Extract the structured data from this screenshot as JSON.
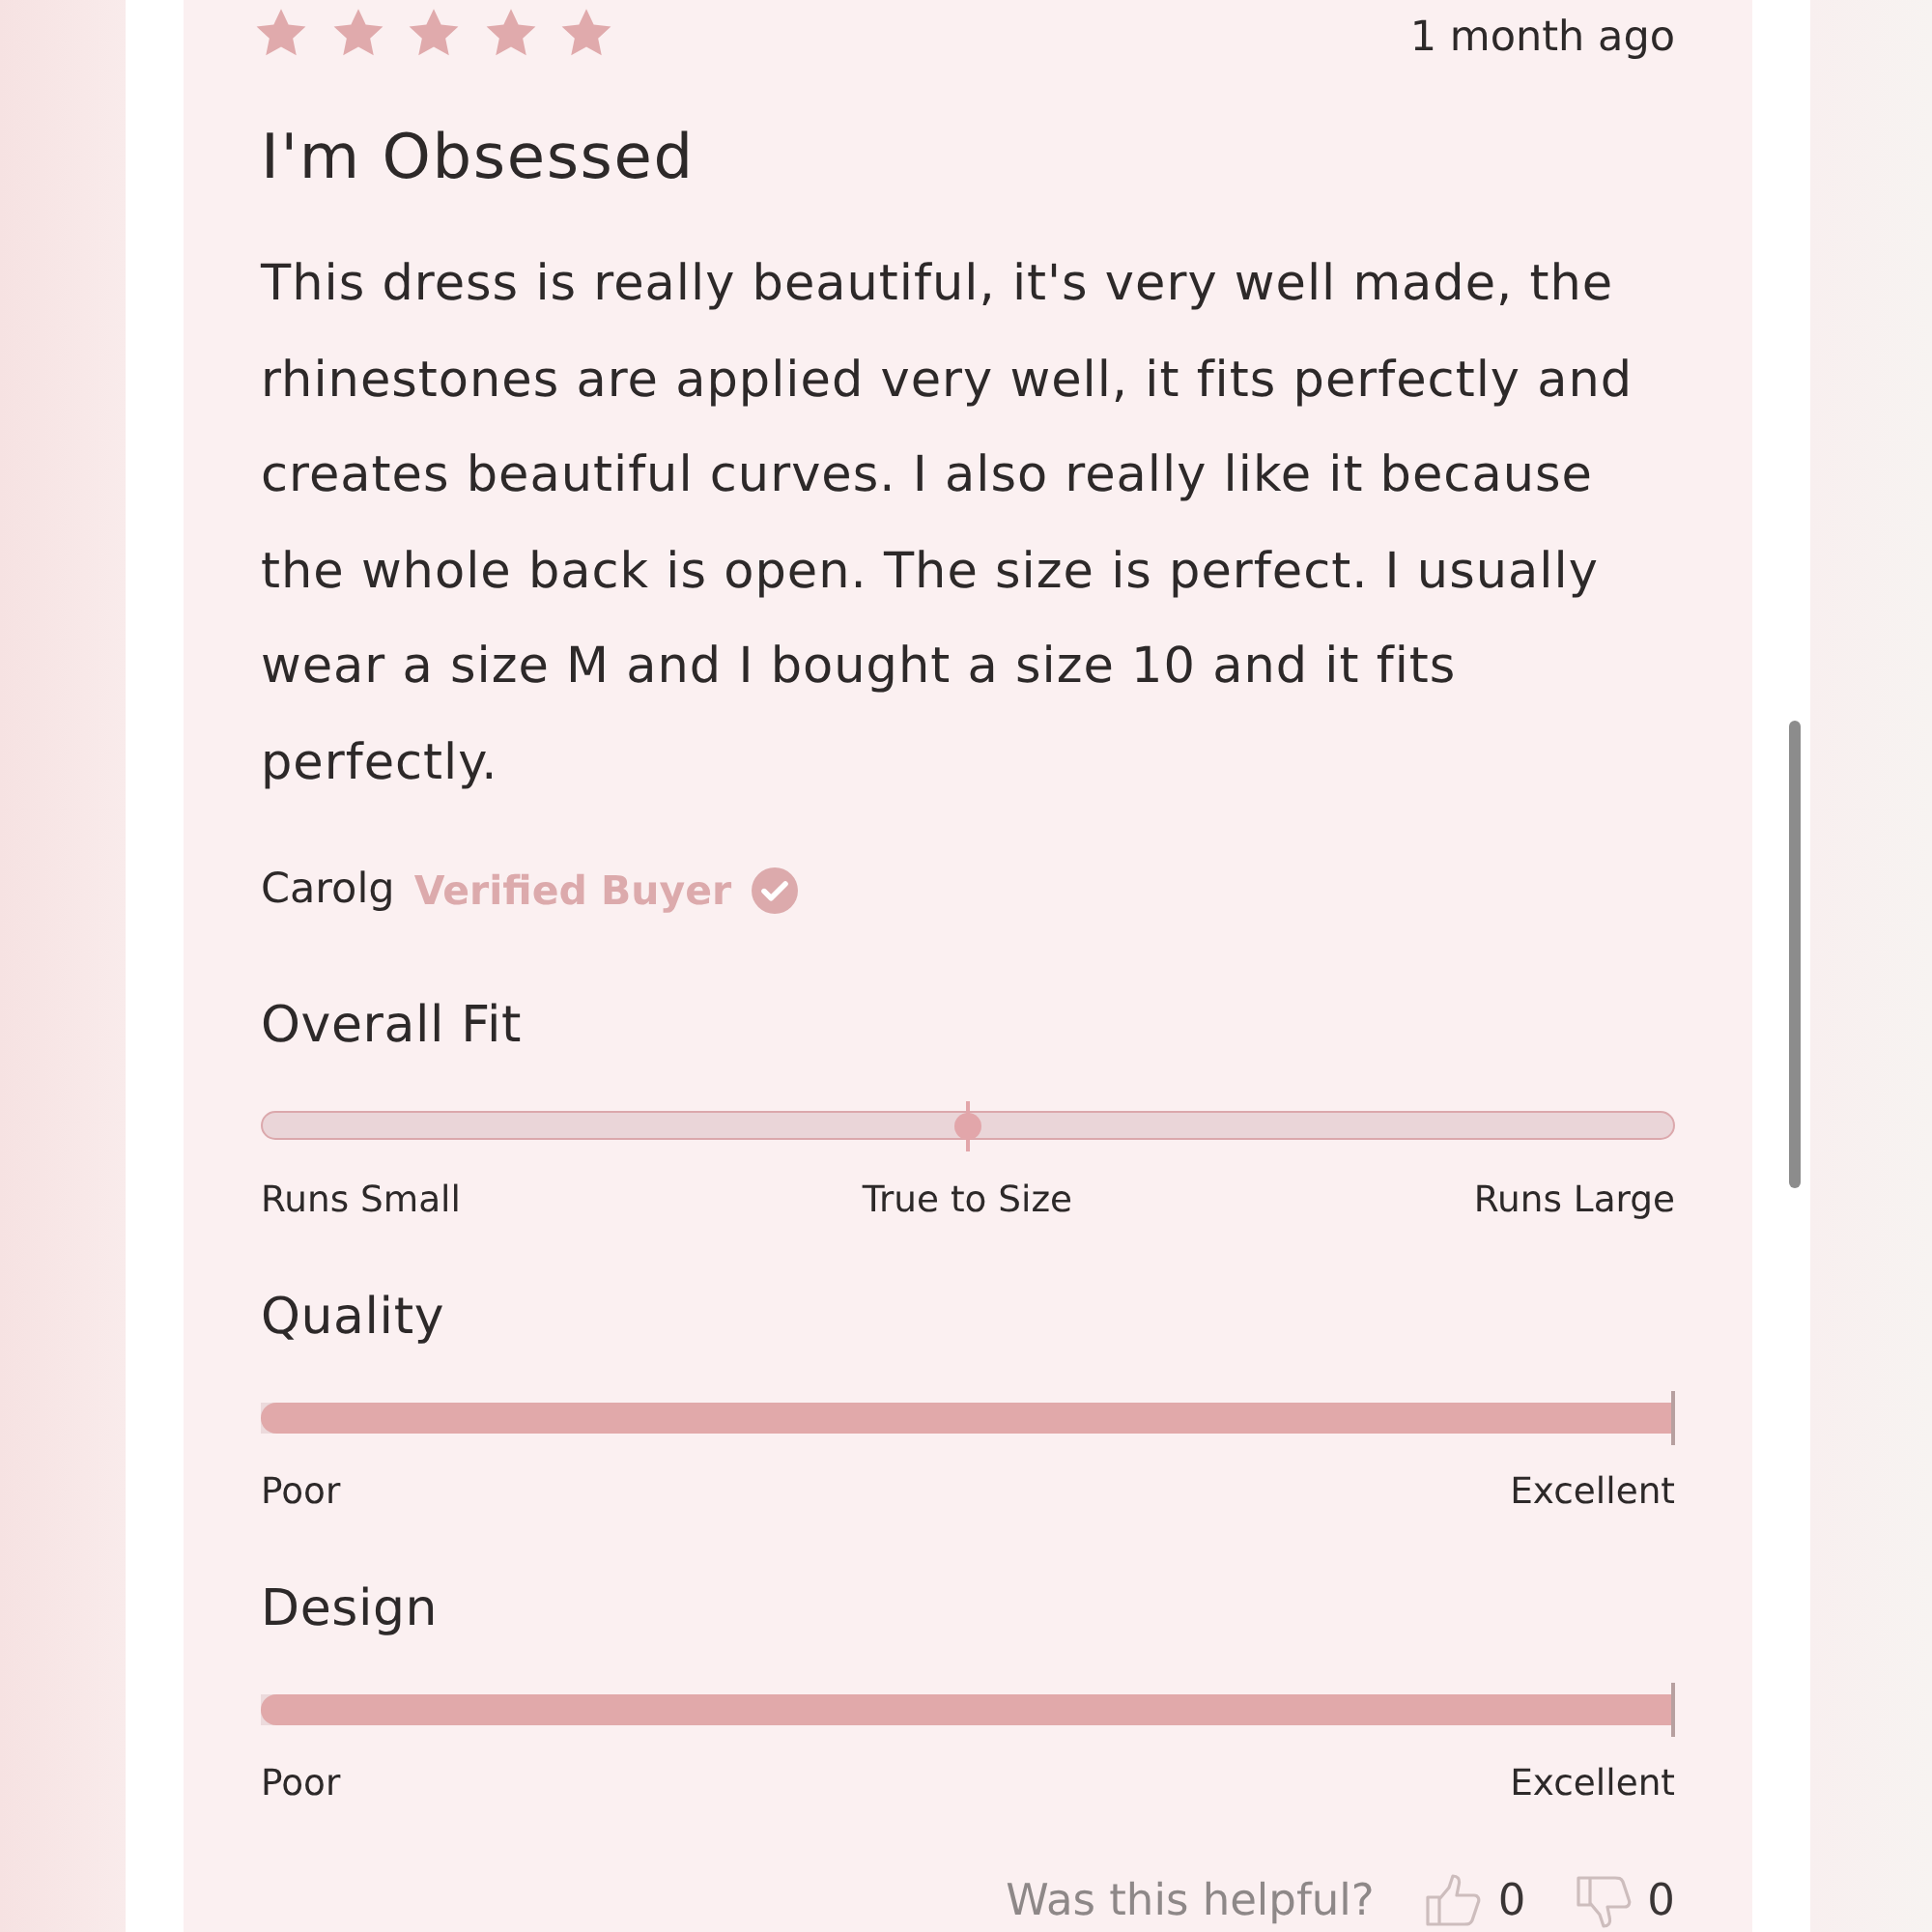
{
  "review": {
    "stars": 5,
    "time": "1 month ago",
    "title": "I'm Obsessed",
    "body": "This dress is really beautiful, it's very well made, the rhinestones are applied very well, it fits perfectly and creates beautiful curves. I also really like it because the whole back is open. The size is perfect. I usually wear a size M and I bought a size 10 and it fits perfectly.",
    "author": "Carolg",
    "badge": "Verified Buyer"
  },
  "ratings": [
    {
      "kind": "thumb",
      "label": "Overall Fit",
      "level": 0.5,
      "scale": [
        "Runs Small",
        "True to Size",
        "Runs Large"
      ]
    },
    {
      "kind": "fill",
      "label": "Quality",
      "level": 1,
      "scale": [
        "Poor",
        "Excellent"
      ]
    },
    {
      "kind": "fill",
      "label": "Design",
      "level": 1,
      "scale": [
        "Poor",
        "Excellent"
      ]
    }
  ],
  "helpful": {
    "prompt": "Was this helpful?",
    "up_count": "0",
    "down_count": "0"
  }
}
